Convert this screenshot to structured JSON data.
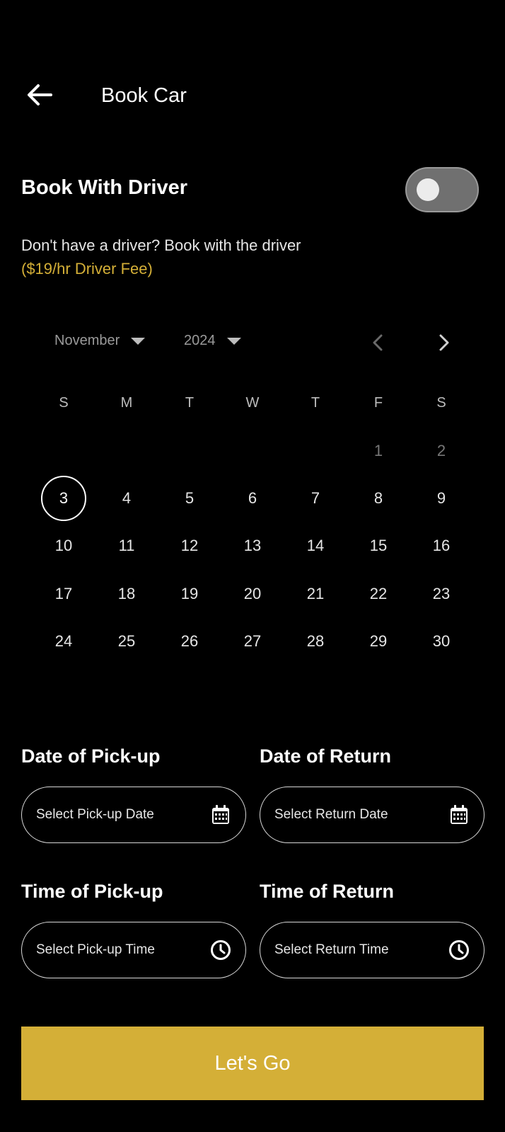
{
  "header": {
    "title": "Book Car",
    "back_icon": "arrow-left-icon"
  },
  "driver": {
    "title": "Book With Driver",
    "toggle_on": false,
    "description": "Don't have a driver? Book with the driver",
    "fee": "($19/hr Driver Fee)",
    "fee_color": "#d4af37"
  },
  "calendar": {
    "month": "November",
    "year": "2024",
    "prev_icon": "chevron-left-icon",
    "next_icon": "chevron-right-icon",
    "weekdays": [
      "S",
      "M",
      "T",
      "W",
      "T",
      "F",
      "S"
    ],
    "weeks": [
      [
        "",
        "",
        "",
        "",
        "",
        "1",
        "2"
      ],
      [
        "3",
        "4",
        "5",
        "6",
        "7",
        "8",
        "9"
      ],
      [
        "10",
        "11",
        "12",
        "13",
        "14",
        "15",
        "16"
      ],
      [
        "17",
        "18",
        "19",
        "20",
        "21",
        "22",
        "23"
      ],
      [
        "24",
        "25",
        "26",
        "27",
        "28",
        "29",
        "30"
      ]
    ],
    "selected_day": "3",
    "muted_days": [
      "1",
      "2"
    ]
  },
  "form": {
    "pickup_date": {
      "label": "Date of Pick-up",
      "placeholder": "Select Pick-up Date",
      "icon": "calendar-icon"
    },
    "return_date": {
      "label": "Date of Return",
      "placeholder": "Select Return Date",
      "icon": "calendar-icon"
    },
    "pickup_time": {
      "label": "Time of Pick-up",
      "placeholder": "Select Pick-up Time",
      "icon": "clock-icon"
    },
    "return_time": {
      "label": "Time of Return",
      "placeholder": "Select Return Time",
      "icon": "clock-icon"
    }
  },
  "cta": {
    "label": "Let's Go",
    "color": "#d4af37"
  }
}
